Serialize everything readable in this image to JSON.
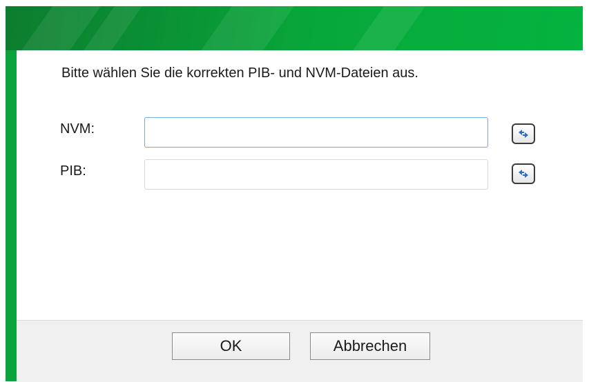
{
  "dialog": {
    "instruction": "Bitte wählen Sie die korrekten PIB- und NVM-Dateien aus.",
    "fields": [
      {
        "label": "NVM:",
        "value": "",
        "browse_icon": "browse-arrows-icon"
      },
      {
        "label": "PIB:",
        "value": "",
        "browse_icon": "browse-arrows-icon"
      }
    ]
  },
  "footer": {
    "ok_label": "OK",
    "cancel_label": "Abbrechen"
  },
  "colors": {
    "header_green": "#0aa83a",
    "footer_bg": "#f0f0f0",
    "icon_blue": "#2a6fc9"
  }
}
